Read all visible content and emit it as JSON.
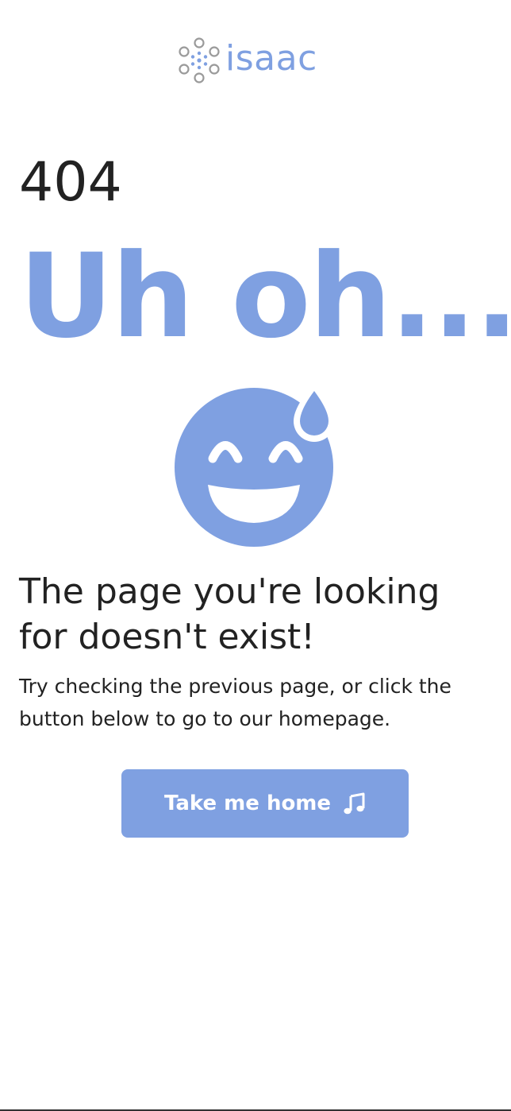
{
  "brand": {
    "logo_text": "isaac",
    "logo_icon": "dots-cluster-icon",
    "color": "#7fa0e1"
  },
  "error": {
    "code": "404",
    "headline": "Uh oh...",
    "emoji_icon": "grinning-face-with-sweat-icon",
    "title": "The page you're looking for doesn't exist!",
    "description": "Try checking the previous page, or click the button below to go to our homepage."
  },
  "actions": {
    "home_button_label": "Take me home",
    "home_button_icon": "music-note-icon"
  },
  "colors": {
    "accent": "#7fa0e1",
    "text": "#222222",
    "background": "#ffffff"
  }
}
